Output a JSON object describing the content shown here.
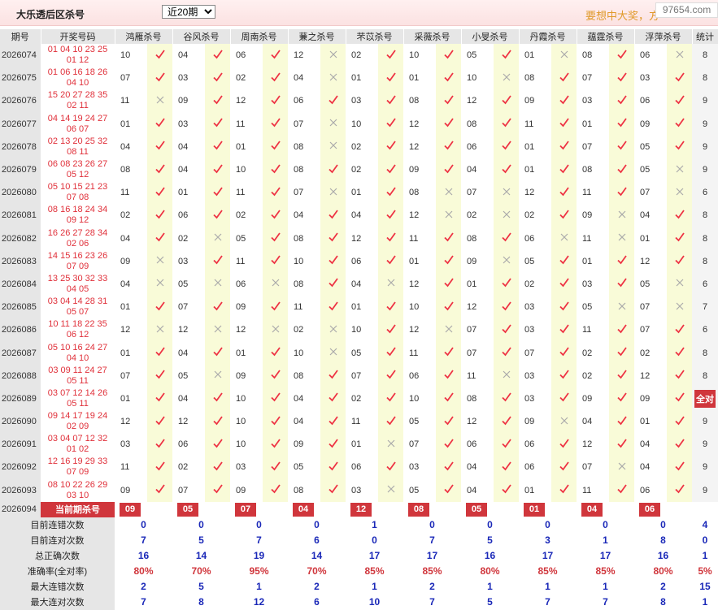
{
  "header": {
    "title": "大乐透后区杀号",
    "range_select": "近20期",
    "marquee": "要想中大奖，方",
    "logo": "97654.com"
  },
  "columns": [
    "期号",
    "开奖号码",
    "鸿雁杀号",
    "谷风杀号",
    "周南杀号",
    "蒹之杀号",
    "芣苡杀号",
    "采薇杀号",
    "小旻杀号",
    "丹霞杀号",
    "蕴霆杀号",
    "浮萍杀号",
    "统计"
  ],
  "rows": [
    {
      "issue": "2026074",
      "draw1": "01 04 10 23 25",
      "draw2": "01 12",
      "kills": [
        "10",
        "04",
        "06",
        "12",
        "02",
        "10",
        "05",
        "01",
        "08",
        "06"
      ],
      "res": "111011101",
      "stat": "8"
    },
    {
      "issue": "2026075",
      "draw1": "01 06 16 18 26",
      "draw2": "04 10",
      "kills": [
        "07",
        "03",
        "02",
        "04",
        "01",
        "01",
        "10",
        "08",
        "07",
        "03"
      ],
      "res": "1110110111",
      "stat": "8"
    },
    {
      "issue": "2026076",
      "draw1": "15 20 27 28 35",
      "draw2": "02 11",
      "kills": [
        "11",
        "09",
        "12",
        "06",
        "03",
        "08",
        "12",
        "09",
        "03",
        "06"
      ],
      "res": "0111111111",
      "stat": "9"
    },
    {
      "issue": "2026077",
      "draw1": "04 14 19 24 27",
      "draw2": "06 07",
      "kills": [
        "01",
        "03",
        "11",
        "07",
        "10",
        "12",
        "08",
        "11",
        "01",
        "09"
      ],
      "res": "1110111111",
      "stat": "9"
    },
    {
      "issue": "2026078",
      "draw1": "02 13 20 25 32",
      "draw2": "08 11",
      "kills": [
        "04",
        "04",
        "01",
        "08",
        "02",
        "12",
        "06",
        "01",
        "07",
        "05"
      ],
      "res": "1110111111",
      "stat": "9"
    },
    {
      "issue": "2026079",
      "draw1": "06 08 23 26 27",
      "draw2": "05 12",
      "kills": [
        "08",
        "04",
        "10",
        "08",
        "02",
        "09",
        "04",
        "01",
        "08",
        "05"
      ],
      "res": "1111111110",
      "stat": "9"
    },
    {
      "issue": "2026080",
      "draw1": "05 10 15 21 23",
      "draw2": "07 08",
      "kills": [
        "11",
        "01",
        "11",
        "07",
        "01",
        "08",
        "07",
        "12",
        "11",
        "07"
      ],
      "res": "1110100110",
      "stat": "6"
    },
    {
      "issue": "2026081",
      "draw1": "08 16 18 24 34",
      "draw2": "09 12",
      "kills": [
        "02",
        "06",
        "02",
        "04",
        "04",
        "12",
        "02",
        "02",
        "09",
        "04"
      ],
      "res": "1111100101",
      "stat": "8"
    },
    {
      "issue": "2026082",
      "draw1": "16 26 27 28 34",
      "draw2": "02 06",
      "kills": [
        "04",
        "02",
        "05",
        "08",
        "12",
        "11",
        "08",
        "06",
        "11",
        "01"
      ],
      "res": "1011111001",
      "stat": "8"
    },
    {
      "issue": "2026083",
      "draw1": "14 15 16 23 26",
      "draw2": "07 09",
      "kills": [
        "09",
        "03",
        "11",
        "10",
        "06",
        "01",
        "09",
        "05",
        "01",
        "12"
      ],
      "res": "0111110111",
      "stat": "8"
    },
    {
      "issue": "2026084",
      "draw1": "13 25 30 32 33",
      "draw2": "04 05",
      "kills": [
        "04",
        "05",
        "06",
        "08",
        "04",
        "12",
        "01",
        "02",
        "03",
        "05"
      ],
      "res": "0001011110",
      "stat": "6"
    },
    {
      "issue": "2026085",
      "draw1": "03 04 14 28 31",
      "draw2": "05 07",
      "kills": [
        "01",
        "07",
        "09",
        "11",
        "01",
        "10",
        "12",
        "03",
        "05",
        "07"
      ],
      "res": "1111111100",
      "stat": "7"
    },
    {
      "issue": "2026086",
      "draw1": "10 11 18 22 35",
      "draw2": "06 12",
      "kills": [
        "12",
        "12",
        "12",
        "02",
        "10",
        "12",
        "07",
        "03",
        "11",
        "07"
      ],
      "res": "0000101111",
      "stat": "6"
    },
    {
      "issue": "2026087",
      "draw1": "05 10 16 24 27",
      "draw2": "04 10",
      "kills": [
        "01",
        "04",
        "01",
        "10",
        "05",
        "11",
        "07",
        "07",
        "02",
        "02"
      ],
      "res": "1110111111",
      "stat": "8"
    },
    {
      "issue": "2026088",
      "draw1": "03 09 11 24 27",
      "draw2": "05 11",
      "kills": [
        "07",
        "05",
        "09",
        "08",
        "07",
        "06",
        "11",
        "03",
        "02",
        "12"
      ],
      "res": "1011110111",
      "stat": "8"
    },
    {
      "issue": "2026089",
      "draw1": "03 07 12 14 26",
      "draw2": "05 11",
      "kills": [
        "01",
        "04",
        "10",
        "04",
        "02",
        "10",
        "08",
        "03",
        "09",
        "09"
      ],
      "res": "1111111111",
      "stat": "全对"
    },
    {
      "issue": "2026090",
      "draw1": "09 14 17 19 24",
      "draw2": "02 09",
      "kills": [
        "12",
        "12",
        "10",
        "04",
        "11",
        "05",
        "12",
        "09",
        "04",
        "01"
      ],
      "res": "1111111011",
      "stat": "9"
    },
    {
      "issue": "2026091",
      "draw1": "03 04 07 12 32",
      "draw2": "01 02",
      "kills": [
        "03",
        "06",
        "10",
        "09",
        "01",
        "07",
        "06",
        "06",
        "12",
        "04"
      ],
      "res": "1111011111",
      "stat": "9"
    },
    {
      "issue": "2026092",
      "draw1": "12 16 19 29 33",
      "draw2": "07 09",
      "kills": [
        "11",
        "02",
        "03",
        "05",
        "06",
        "03",
        "04",
        "06",
        "07",
        "04"
      ],
      "res": "1111111101",
      "stat": "9"
    },
    {
      "issue": "2026093",
      "draw1": "08 10 22 26 29",
      "draw2": "03 10",
      "kills": [
        "09",
        "07",
        "09",
        "08",
        "03",
        "05",
        "04",
        "01",
        "11",
        "06"
      ],
      "res": "1111011111",
      "stat": "9"
    }
  ],
  "current": {
    "issue": "2026094",
    "label": "当前期杀号",
    "picks": [
      "09",
      "05",
      "07",
      "04",
      "12",
      "08",
      "05",
      "01",
      "04",
      "06"
    ]
  },
  "stats": [
    {
      "label": "目前连错次数",
      "values": [
        "0",
        "0",
        "0",
        "0",
        "1",
        "0",
        "0",
        "0",
        "0",
        "0",
        "4"
      ]
    },
    {
      "label": "目前连对次数",
      "values": [
        "7",
        "5",
        "7",
        "6",
        "0",
        "7",
        "5",
        "3",
        "1",
        "8",
        "0"
      ]
    },
    {
      "label": "总正确次数",
      "values": [
        "16",
        "14",
        "19",
        "14",
        "17",
        "17",
        "16",
        "17",
        "17",
        "16",
        "1"
      ]
    },
    {
      "label": "准确率(全对率)",
      "values": [
        "80%",
        "70%",
        "95%",
        "70%",
        "85%",
        "85%",
        "80%",
        "85%",
        "85%",
        "80%",
        "5%"
      ]
    },
    {
      "label": "最大连错次数",
      "values": [
        "2",
        "5",
        "1",
        "2",
        "1",
        "2",
        "1",
        "1",
        "1",
        "2",
        "15"
      ]
    },
    {
      "label": "最大连对次数",
      "values": [
        "7",
        "8",
        "12",
        "6",
        "10",
        "7",
        "5",
        "7",
        "7",
        "8",
        "1"
      ]
    }
  ]
}
